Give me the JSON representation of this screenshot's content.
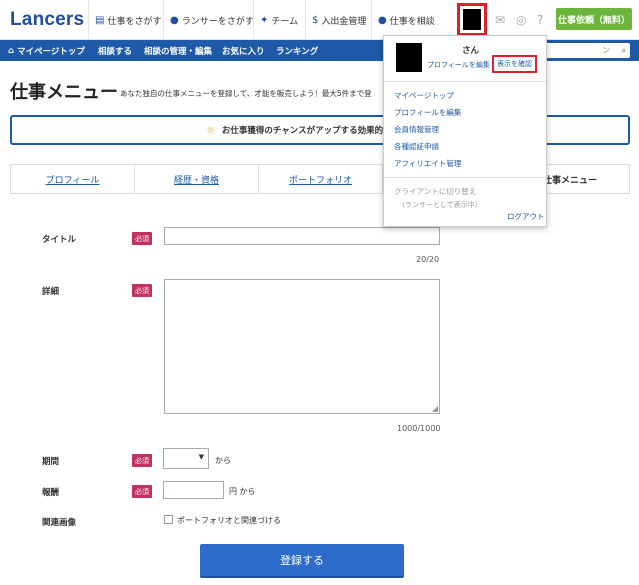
{
  "header": {
    "logo": "Lancers",
    "nav": [
      {
        "label": "仕事をさがす",
        "icon": "folder-icon"
      },
      {
        "label": "ランサーをさがす",
        "icon": "person-icon"
      },
      {
        "label": "チーム",
        "icon": "team-icon"
      },
      {
        "label": "入出金管理",
        "icon": "money-bag-icon"
      },
      {
        "label": "仕事を相談",
        "icon": "speech-bubble-icon"
      }
    ],
    "cta": "仕事依頼（無料）"
  },
  "subnav": {
    "items": [
      "マイページトップ",
      "相談する",
      "相談の管理・編集",
      "お気に入り",
      "ランキング"
    ],
    "search_fragment": "ン"
  },
  "page": {
    "title": "仕事メニュー",
    "description": "あなた独自の仕事メニューを登録して、才能を販売しよう！最大5件まで登",
    "banner": "お仕事獲得のチャンスがアップする効果的なプロフィー"
  },
  "tabs": [
    "プロフィール",
    "経歴・資格",
    "ポートフォリオ",
    "",
    "仕事メニュー"
  ],
  "form": {
    "required_badge": "必須",
    "title_label": "タイトル",
    "title_counter": "20/20",
    "detail_label": "詳細",
    "detail_counter": "1000/1000",
    "period_label": "期間",
    "period_suffix": "から",
    "reward_label": "報酬",
    "reward_suffix": "円 から",
    "image_label": "関連画像",
    "portfolio_checkbox": "ポートフォリオと関連づける",
    "submit": "登録する"
  },
  "dropdown": {
    "name": "さん",
    "edit_profile": "プロフィールを編集",
    "view_profile": "表示を確認",
    "items": [
      "マイページトップ",
      "プロフィールを編集",
      "会員情報管理",
      "各種認証申請",
      "アフィリエイト管理"
    ],
    "switch_client": "クライアントに切り替え",
    "status": "（ランサーとして表示中）",
    "logout": "ログアウト"
  },
  "colors": {
    "brand": "#1f5aa8",
    "cta": "#6cb53c",
    "required": "#c4305f",
    "highlight": "#d9232f"
  }
}
